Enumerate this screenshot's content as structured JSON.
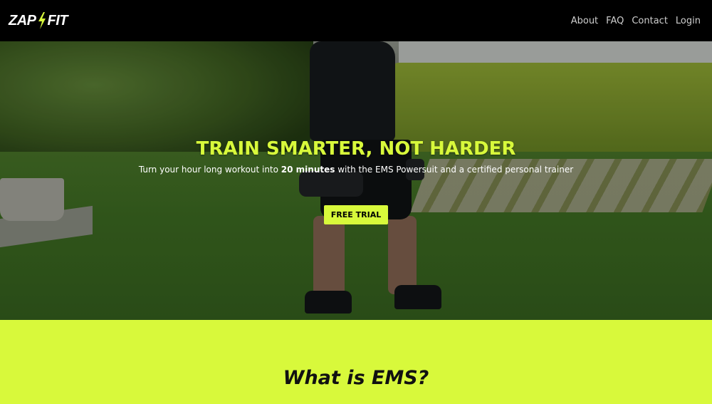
{
  "brand": {
    "logo_left": "ZAP",
    "logo_right": "FIT",
    "accent_color": "#d8f93b"
  },
  "nav": {
    "items": [
      {
        "label": "About"
      },
      {
        "label": "FAQ"
      },
      {
        "label": "Contact"
      },
      {
        "label": "Login"
      }
    ]
  },
  "hero": {
    "title": "TRAIN SMARTER, NOT HARDER",
    "subtitle_before": "Turn your hour long workout into ",
    "subtitle_bold": "20 minutes",
    "subtitle_after": " with the EMS Powersuit and a certified personal trainer",
    "cta_label": "FREE TRIAL"
  },
  "section_ems": {
    "title": "What is EMS?"
  }
}
